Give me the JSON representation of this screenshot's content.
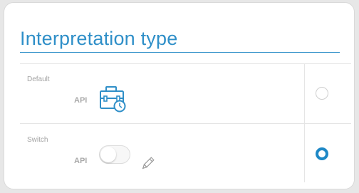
{
  "card": {
    "title": "Interpretation type"
  },
  "rows": [
    {
      "label": "Default",
      "api": "API",
      "icon": "briefcase-clock-icon",
      "selected": false
    },
    {
      "label": "Switch",
      "api": "API",
      "icon": "toggle-switch-icon",
      "secondary_icon": "pencil-icon",
      "selected": true
    }
  ],
  "colors": {
    "accent": "#2f8fc8",
    "radio_selected": "#1e88c6",
    "muted_text": "#a3a3a3"
  }
}
